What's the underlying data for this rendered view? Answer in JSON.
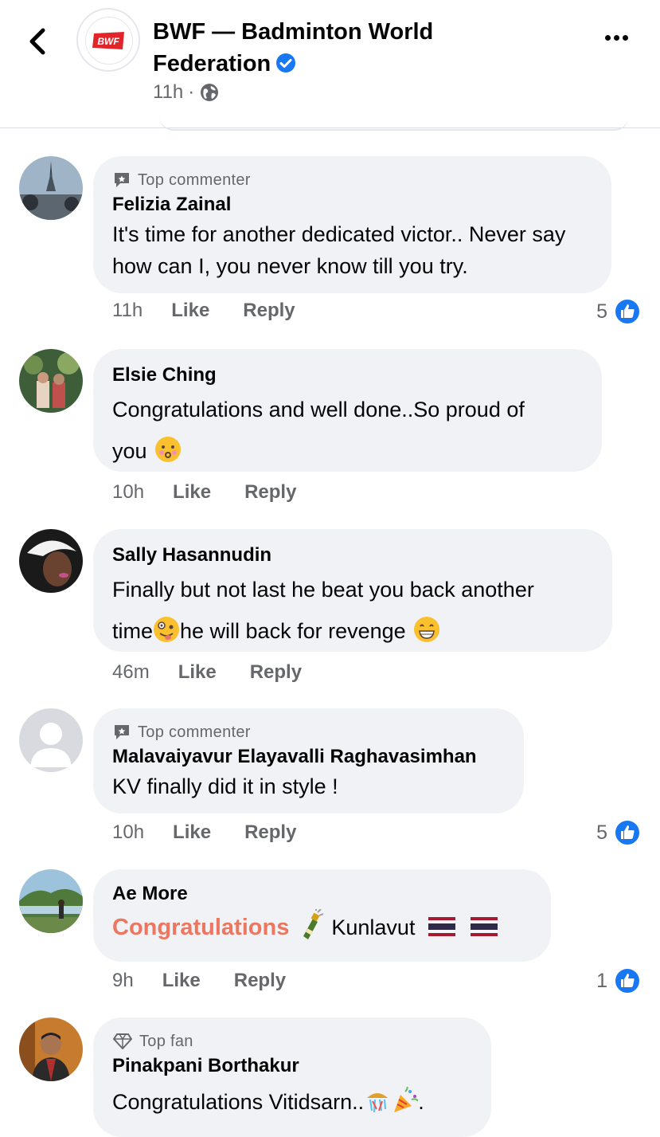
{
  "header": {
    "page_name": "BWF — Badminton World Federation",
    "logo_text": "BWF",
    "time": "11h",
    "separator": "·"
  },
  "comments": [
    {
      "badge": "Top commenter",
      "author": "Felizia Zainal",
      "text": "It's time for another dedicated victor.. Never say how can I, you never know till you try.",
      "time": "11h",
      "like_label": "Like",
      "reply_label": "Reply",
      "reaction_count": "5"
    },
    {
      "author": "Elsie Ching",
      "text_line1": "Congratulations and well done..So proud of",
      "text_line2": "you",
      "emoji": "kissing-face-icon",
      "time": "10h",
      "like_label": "Like",
      "reply_label": "Reply"
    },
    {
      "author": "Sally Hasannudin",
      "text_line1": "Finally but not last he beat you back another",
      "text_part_a": "time",
      "text_part_b": "he will back for revenge",
      "emoji1": "zany-face-icon",
      "emoji2": "grinning-face-icon",
      "time": "46m",
      "like_label": "Like",
      "reply_label": "Reply"
    },
    {
      "badge": "Top commenter",
      "author": "Malavaiyavur Elayavalli Raghavasimhan",
      "text": "KV finally did it in style !",
      "time": "10h",
      "like_label": "Like",
      "reply_label": "Reply",
      "reaction_count": "5"
    },
    {
      "author": "Ae More",
      "highlight": "Congratulations",
      "text_after": "Kunlavut",
      "emoji1": "champagne-icon",
      "emoji2": "thailand-flag-icon",
      "time": "9h",
      "like_label": "Like",
      "reply_label": "Reply",
      "reaction_count": "1"
    },
    {
      "badge": "Top fan",
      "author": "Pinakpani Borthakur",
      "text": "Congratulations Vitidsarn..",
      "text_end": ".",
      "emoji1": "confetti-ball-icon",
      "emoji2": "party-popper-icon"
    }
  ],
  "colors": {
    "accent_blue": "#1877f2",
    "bubble_bg": "#f0f2f5",
    "secondary_text": "#65676b",
    "highlight_orange": "#ec7660",
    "bwf_red": "#e0262b"
  }
}
